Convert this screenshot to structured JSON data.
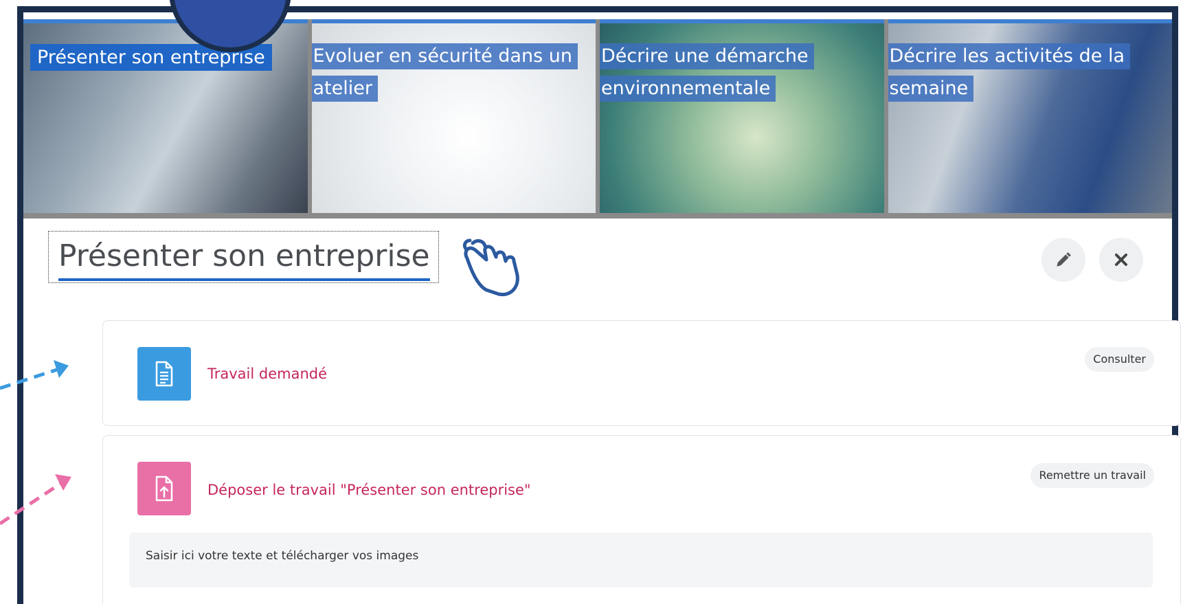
{
  "tiles": [
    {
      "label": "Présenter son entreprise"
    },
    {
      "label": "Evoluer en sécurité dans un atelier"
    },
    {
      "label": "Décrire une démarche environnementale"
    },
    {
      "label": "Décrire les activités de la semaine"
    }
  ],
  "section": {
    "title": "Présenter son entreprise"
  },
  "activities": [
    {
      "label": "Travail demandé",
      "action": "Consulter",
      "icon": "file-text-icon",
      "color": "#3b9be0"
    },
    {
      "label": "Déposer le travail \"Présenter son entreprise\"",
      "action": "Remettre un travail",
      "icon": "upload-file-icon",
      "color": "#e96fa7",
      "description": "Saisir ici votre texte et télécharger vos images"
    }
  ],
  "annotations": {
    "arrow_blue_color": "#3b9be0",
    "arrow_pink_color": "#e96fa7",
    "hand_icon": "pointing-hand-icon"
  }
}
